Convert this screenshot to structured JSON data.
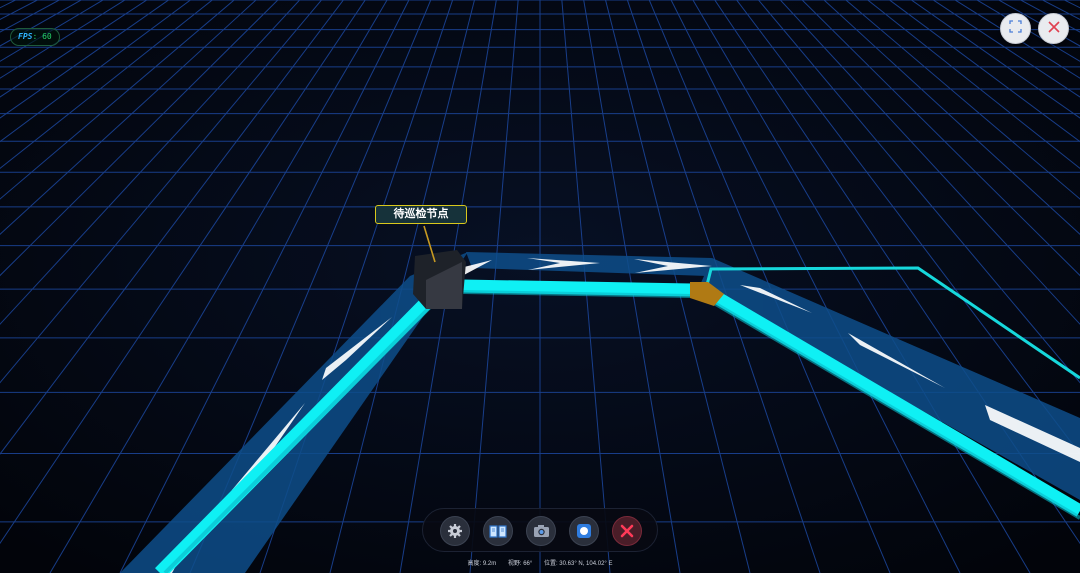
{
  "hud": {
    "fps_label": "FPS",
    "fps_value": ": 60"
  },
  "window_controls": {
    "fullscreen_icon": "fullscreen-icon",
    "close_icon": "close-icon"
  },
  "scene": {
    "node_label": "待巡检节点",
    "grid_color": "#1f4fb0",
    "pipe_color": "#0ff0f4",
    "flow_band_color": "#0e4e8a",
    "joint_color": "#b07a14"
  },
  "toolbar": {
    "buttons": [
      {
        "name": "settings",
        "icon": "gear-icon"
      },
      {
        "name": "guide",
        "icon": "book-icon"
      },
      {
        "name": "screenshot",
        "icon": "camera-icon"
      },
      {
        "name": "record",
        "icon": "record-icon"
      },
      {
        "name": "exit",
        "icon": "close-icon"
      }
    ]
  },
  "status": {
    "height": "高度: 9.2m",
    "fov": "视野: 66°",
    "position": "位置: 30.63° N, 104.02° E"
  }
}
